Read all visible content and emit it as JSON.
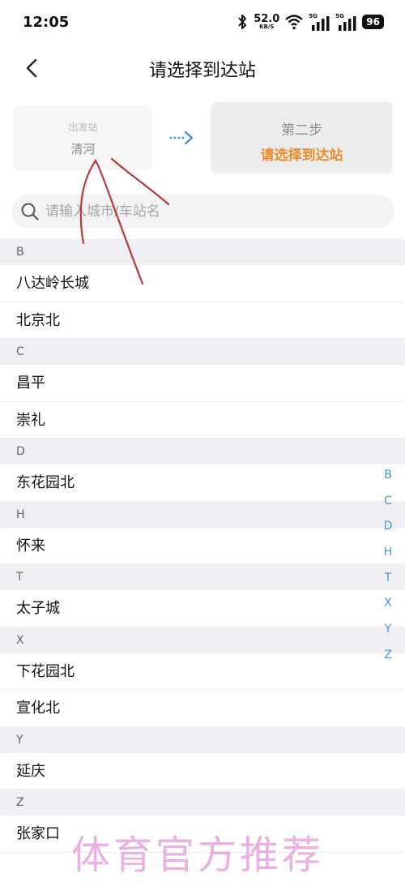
{
  "status": {
    "time": "12:05",
    "speed_value": "52.0",
    "speed_unit": "KB/S",
    "sim1_label": "5G",
    "sim2_label": "5G",
    "battery": "96"
  },
  "nav": {
    "title": "请选择到达站"
  },
  "steps": {
    "from_label": "出发站",
    "from_value": "清河",
    "to_label": "第二步",
    "to_value": "请选择到达站",
    "accent": "#ee8a2a"
  },
  "search": {
    "placeholder": "请输入城市/车站名"
  },
  "sections": [
    {
      "letter": "B",
      "stations": [
        "八达岭长城",
        "北京北"
      ]
    },
    {
      "letter": "C",
      "stations": [
        "昌平",
        "崇礼"
      ]
    },
    {
      "letter": "D",
      "stations": [
        "东花园北"
      ]
    },
    {
      "letter": "H",
      "stations": [
        "怀来"
      ]
    },
    {
      "letter": "T",
      "stations": [
        "太子城"
      ]
    },
    {
      "letter": "X",
      "stations": [
        "下花园北",
        "宣化北"
      ]
    },
    {
      "letter": "Y",
      "stations": [
        "延庆"
      ]
    },
    {
      "letter": "Z",
      "stations": [
        "张家口"
      ]
    }
  ],
  "index": [
    "B",
    "C",
    "D",
    "H",
    "T",
    "X",
    "Y",
    "Z"
  ],
  "watermark": "体育官方推荐"
}
